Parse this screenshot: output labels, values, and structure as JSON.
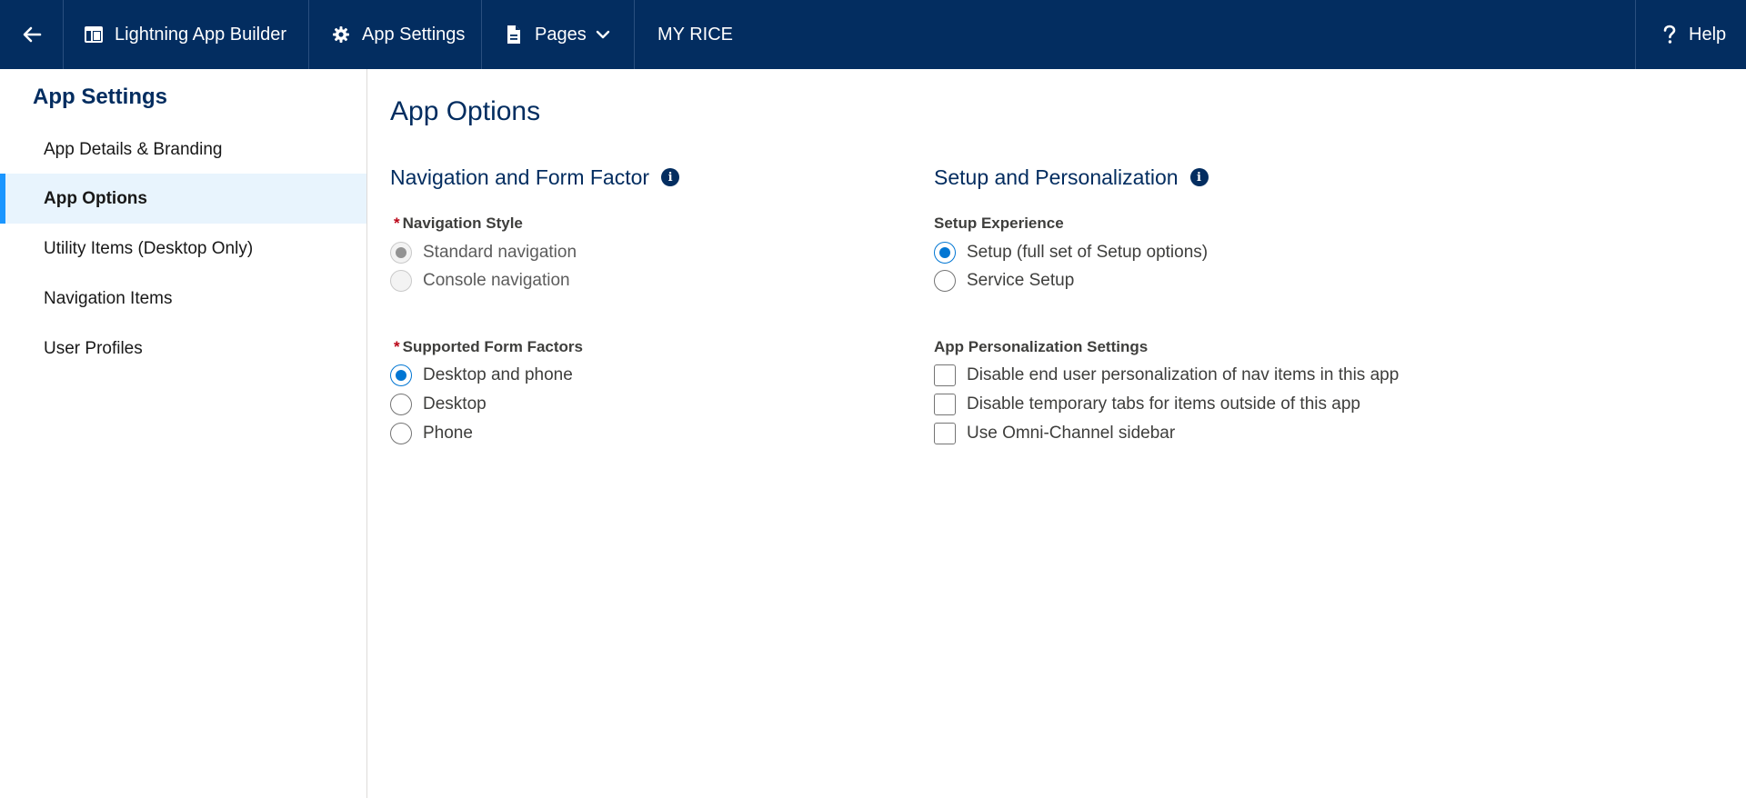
{
  "topbar": {
    "back_icon": "arrow-left-icon",
    "builder_label": "Lightning App Builder",
    "builder_icon": "app-builder-icon",
    "settings_label": "App Settings",
    "settings_icon": "gear-icon",
    "pages_label": "Pages",
    "pages_icon": "page-icon",
    "app_name": "MY RICE",
    "help_label": "Help",
    "help_icon": "question-icon",
    "bg_color": "#032d60"
  },
  "sidebar": {
    "title": "App Settings",
    "items": [
      {
        "label": "App Details & Branding",
        "active": false
      },
      {
        "label": "App Options",
        "active": true
      },
      {
        "label": "Utility Items (Desktop Only)",
        "active": false
      },
      {
        "label": "Navigation Items",
        "active": false
      },
      {
        "label": "User Profiles",
        "active": false
      }
    ]
  },
  "main": {
    "title": "App Options",
    "nav_section": {
      "title": "Navigation and Form Factor",
      "nav_style": {
        "label": "Navigation Style",
        "required_mark": "*",
        "options": [
          {
            "label": "Standard navigation",
            "selected": true,
            "disabled": true
          },
          {
            "label": "Console navigation",
            "selected": false,
            "disabled": true
          }
        ]
      },
      "form_factors": {
        "label": "Supported Form Factors",
        "required_mark": "*",
        "options": [
          {
            "label": "Desktop and phone",
            "selected": true
          },
          {
            "label": "Desktop",
            "selected": false
          },
          {
            "label": "Phone",
            "selected": false
          }
        ]
      }
    },
    "setup_section": {
      "title": "Setup and Personalization",
      "setup_experience": {
        "label": "Setup Experience",
        "options": [
          {
            "label": "Setup (full set of Setup options)",
            "selected": true
          },
          {
            "label": "Service Setup",
            "selected": false
          }
        ]
      },
      "personalization": {
        "label": "App Personalization Settings",
        "options": [
          {
            "label": "Disable end user personalization of nav items in this app",
            "checked": false
          },
          {
            "label": "Disable temporary tabs for items outside of this app",
            "checked": false
          },
          {
            "label": "Use Omni-Channel sidebar",
            "checked": false
          }
        ]
      }
    }
  },
  "colors": {
    "accent": "#0176d3",
    "active_bar": "#1b96ff",
    "heading": "#032d60",
    "required": "#ba0517"
  }
}
